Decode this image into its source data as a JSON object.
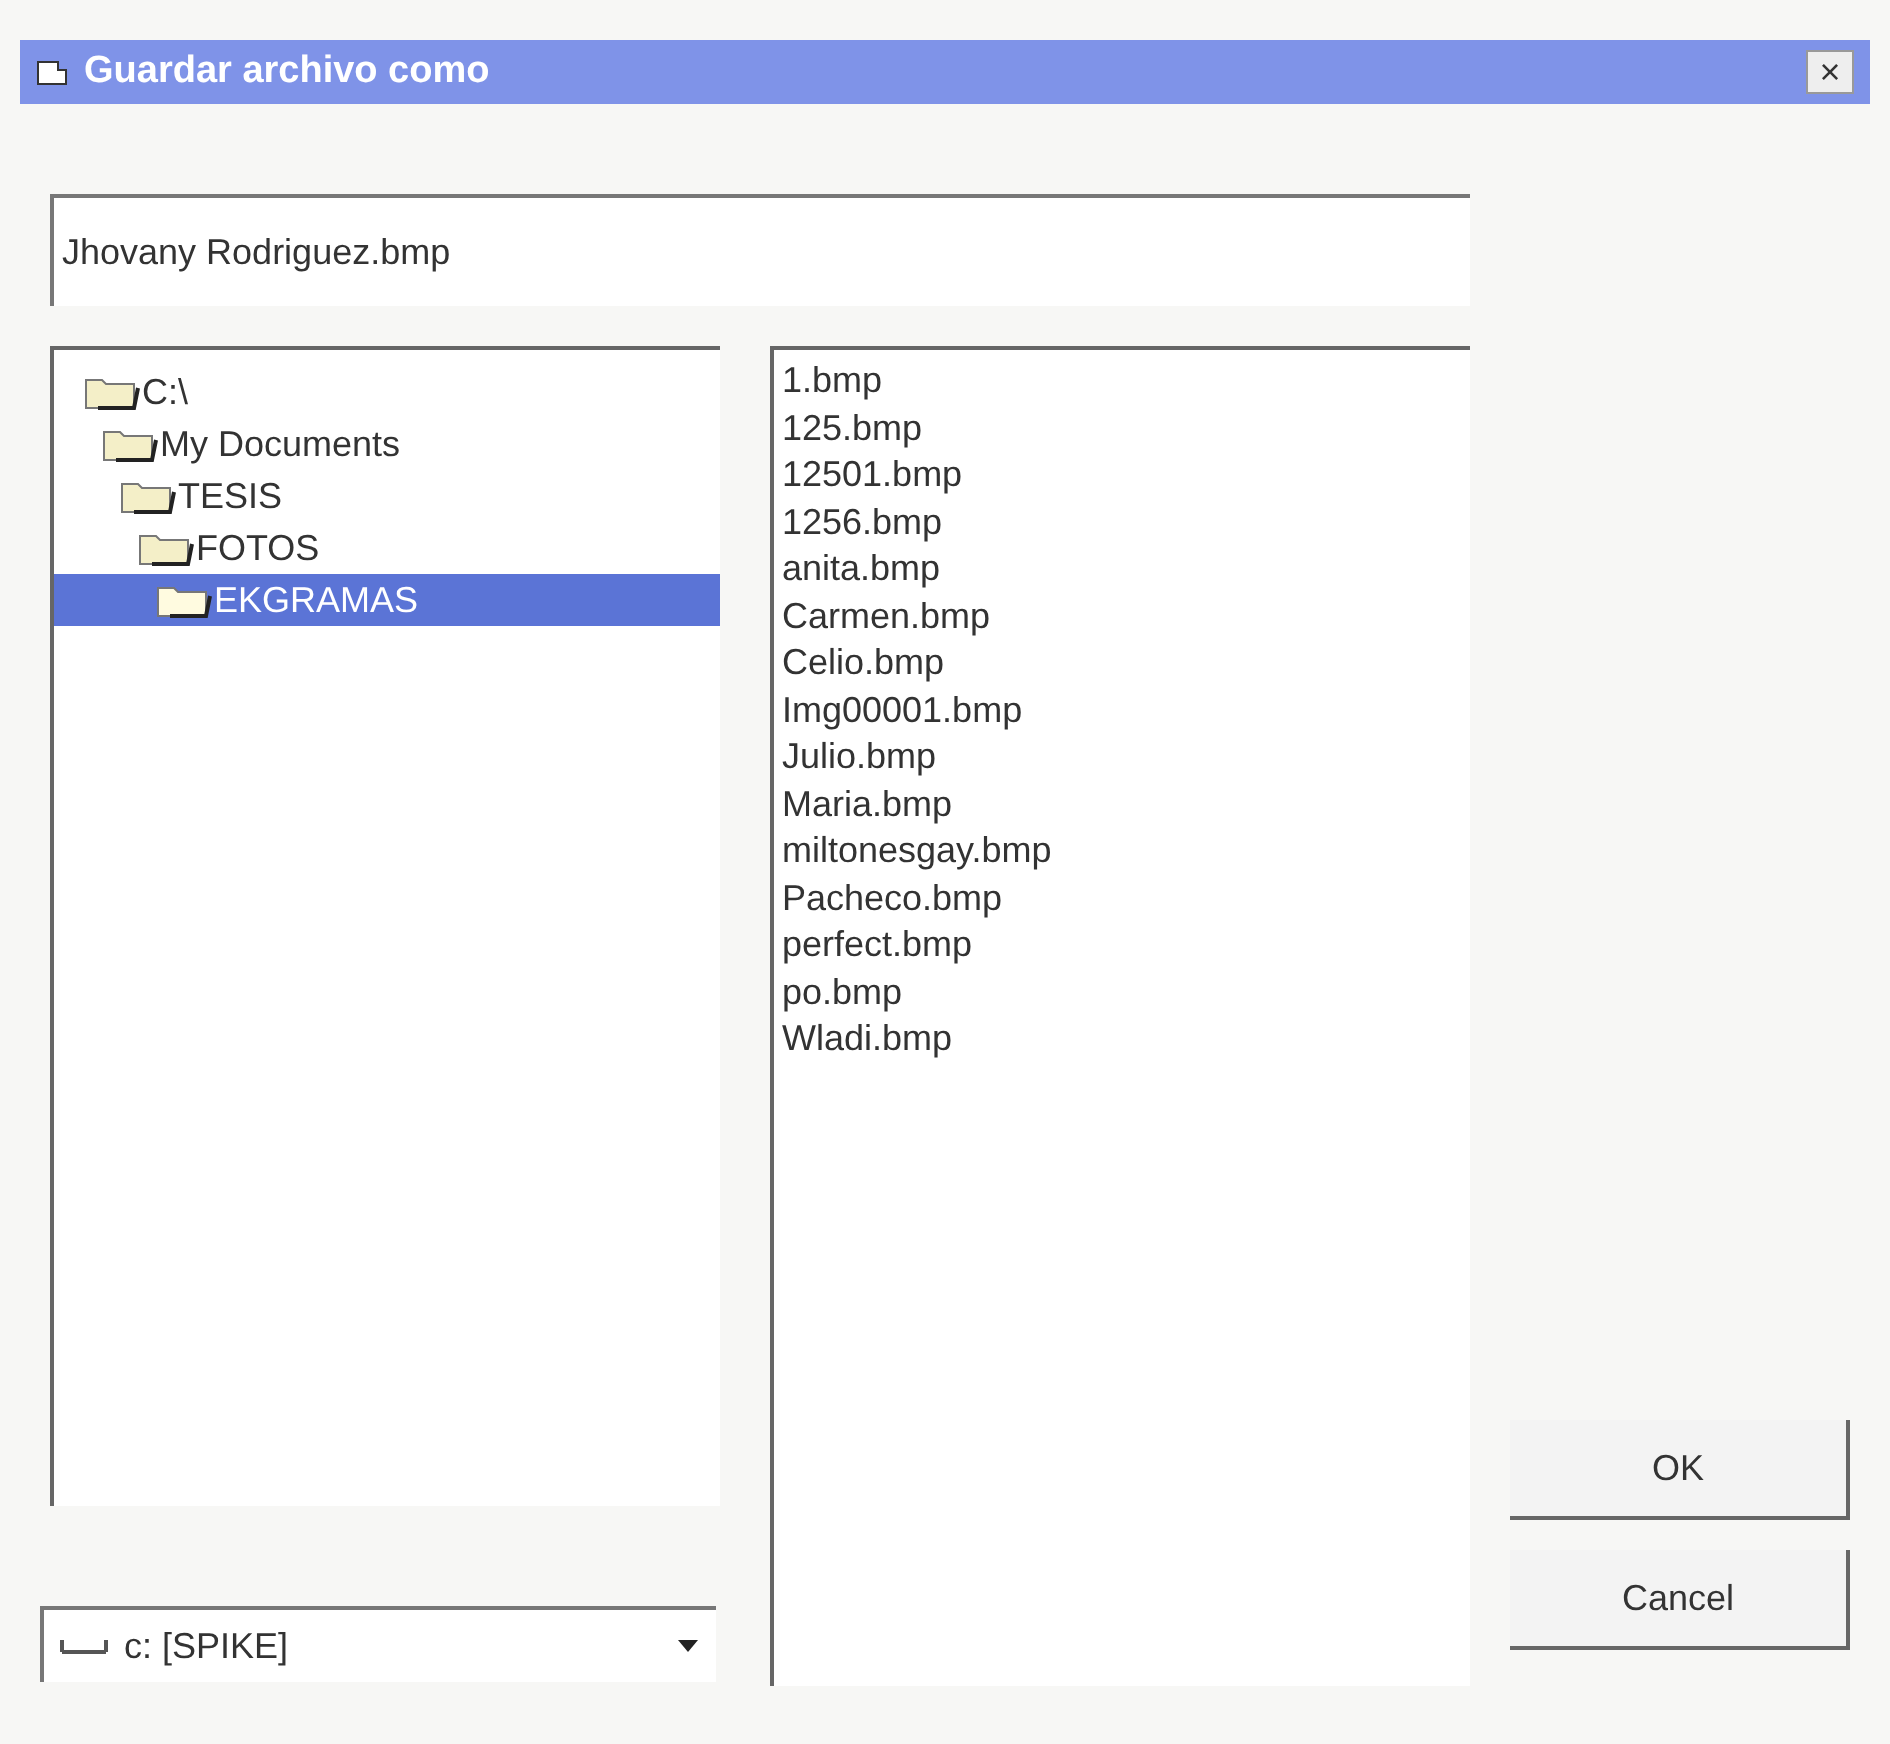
{
  "window": {
    "title": "Guardar archivo como",
    "close": "×"
  },
  "filename_field": {
    "value": "Jhovany Rodriguez.bmp"
  },
  "folder_tree": [
    {
      "label": "C:\\",
      "selected": false,
      "children": [
        {
          "label": "My Documents",
          "selected": false,
          "children": [
            {
              "label": "TESIS",
              "selected": false,
              "children": [
                {
                  "label": "FOTOS",
                  "selected": false,
                  "children": [
                    {
                      "label": "EKGRAMAS",
                      "selected": true
                    }
                  ]
                }
              ]
            }
          ]
        }
      ]
    }
  ],
  "files": [
    "1.bmp",
    "125.bmp",
    "12501.bmp",
    "1256.bmp",
    "anita.bmp",
    "Carmen.bmp",
    "Celio.bmp",
    "Img00001.bmp",
    "Julio.bmp",
    "Maria.bmp",
    "miltonesgay.bmp",
    "Pacheco.bmp",
    "perfect.bmp",
    "po.bmp",
    "Wladi.bmp"
  ],
  "drive_select": {
    "value": "c: [SPIKE]"
  },
  "buttons": [
    "OK",
    "Cancel"
  ]
}
